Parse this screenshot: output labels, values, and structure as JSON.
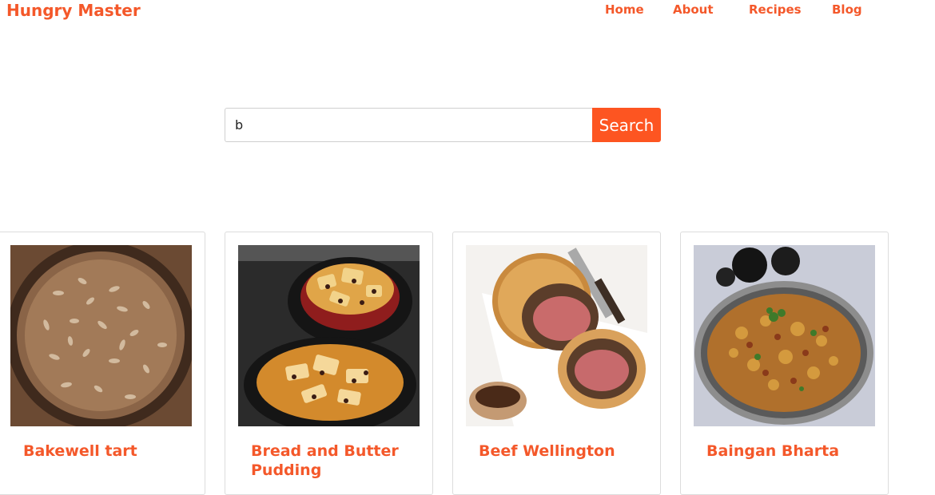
{
  "brand": {
    "name": "Hungry Master"
  },
  "nav": {
    "items": [
      "Home",
      "About",
      "Recipes",
      "Blog"
    ]
  },
  "search": {
    "value": "b",
    "button_label": "Search"
  },
  "recipes": [
    {
      "title": "Bakewell tart",
      "image": "bakewell-tart-photo"
    },
    {
      "title": "Bread and Butter Pudding",
      "image": "bread-and-butter-pudding-photo"
    },
    {
      "title": "Beef Wellington",
      "image": "beef-wellington-photo"
    },
    {
      "title": "Baingan Bharta",
      "image": "baingan-bharta-photo"
    }
  ],
  "colors": {
    "accent": "#f4582a",
    "button": "#fd5521"
  }
}
